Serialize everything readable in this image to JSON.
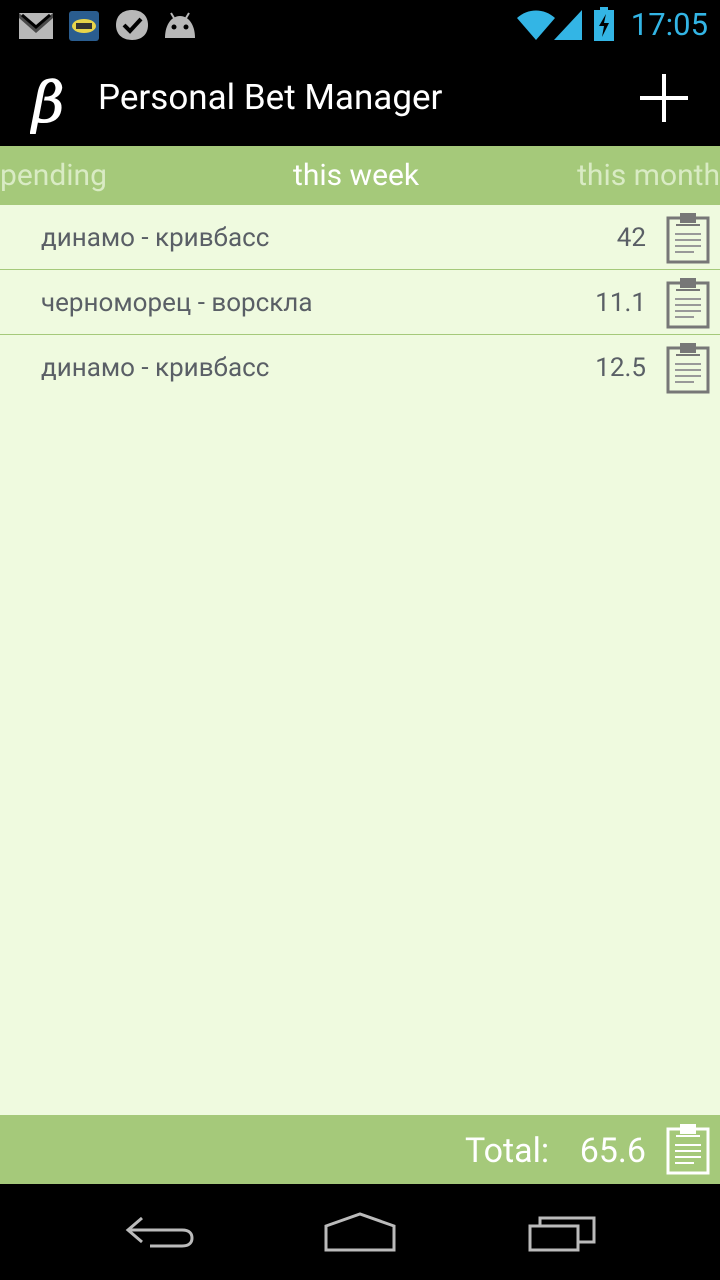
{
  "status_bar": {
    "time": "17:05",
    "icons": [
      "gmail-icon",
      "fish-app-icon",
      "check-app-icon",
      "android-icon",
      "wifi-icon",
      "signal-icon",
      "battery-charging-icon"
    ],
    "time_color": "#33b5e5"
  },
  "action_bar": {
    "title": "Personal Bet Manager",
    "logo_icon": "beta-logo-icon",
    "action_icon": "add-icon"
  },
  "tabs": {
    "left": "pending",
    "center": "this week",
    "right": "this month"
  },
  "bets": [
    {
      "name": "динамо - кривбасс",
      "value": "42"
    },
    {
      "name": "черноморец - ворскла",
      "value": "11.1"
    },
    {
      "name": "динамо - кривбасс",
      "value": "12.5"
    }
  ],
  "footer": {
    "total_label": "Total:",
    "total_value": "65.6"
  },
  "nav_bar": {
    "icons": [
      "back-icon",
      "home-icon",
      "recent-apps-icon"
    ]
  },
  "colors": {
    "accent_green": "#a5c97a",
    "list_background": "#effadf",
    "text_gray": "#5a5f66"
  }
}
